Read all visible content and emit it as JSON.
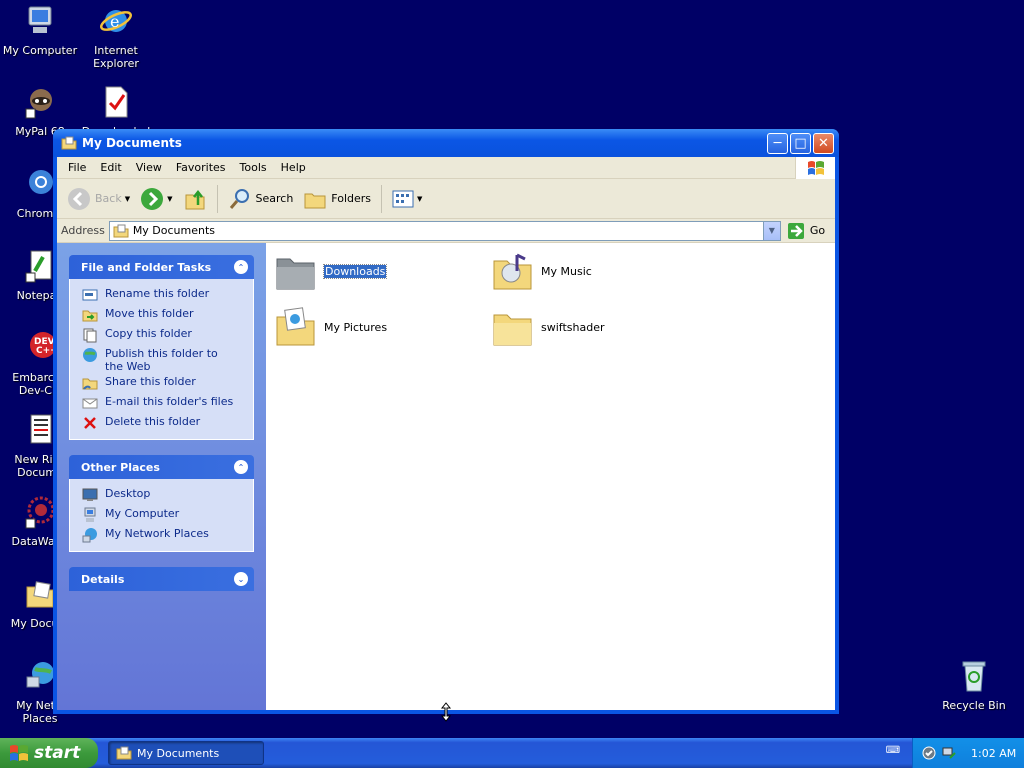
{
  "desktop": {
    "icons": [
      {
        "label": "My Computer"
      },
      {
        "label": "Internet Explorer"
      },
      {
        "label": "MyPal 68"
      },
      {
        "label": "Downloaded"
      },
      {
        "label": "Chromiu"
      },
      {
        "label": "Notepad"
      },
      {
        "label": "Embarcad Dev-C+"
      },
      {
        "label": "New Rich Docume"
      },
      {
        "label": "DataWago"
      },
      {
        "label": "My Docum"
      },
      {
        "label": "My Netw Places"
      },
      {
        "label": "Recycle Bin"
      }
    ]
  },
  "window": {
    "title": "My Documents",
    "menu": [
      "File",
      "Edit",
      "View",
      "Favorites",
      "Tools",
      "Help"
    ],
    "toolbar": {
      "back": "Back",
      "search": "Search",
      "folders": "Folders"
    },
    "address": {
      "label": "Address",
      "value": "My Documents",
      "go": "Go"
    },
    "tasks": {
      "file_folder": {
        "title": "File and Folder Tasks",
        "items": [
          "Rename this folder",
          "Move this folder",
          "Copy this folder",
          "Publish this folder to the Web",
          "Share this folder",
          "E-mail this folder's files",
          "Delete this folder"
        ]
      },
      "other_places": {
        "title": "Other Places",
        "items": [
          "Desktop",
          "My Computer",
          "My Network Places"
        ]
      },
      "details": {
        "title": "Details"
      }
    },
    "files": [
      {
        "name": "Downloads",
        "selected": true
      },
      {
        "name": "My Music",
        "selected": false
      },
      {
        "name": "My Pictures",
        "selected": false
      },
      {
        "name": "swiftshader",
        "selected": false
      }
    ]
  },
  "taskbar": {
    "start": "start",
    "task_button": "My Documents",
    "clock": "1:02 AM"
  },
  "colors": {
    "desktop": "#000066",
    "xp_blue": "#0a55e4",
    "taskpane": "#6f8fe0",
    "selection": "#316ac5",
    "start_green": "#3c9a3c"
  }
}
